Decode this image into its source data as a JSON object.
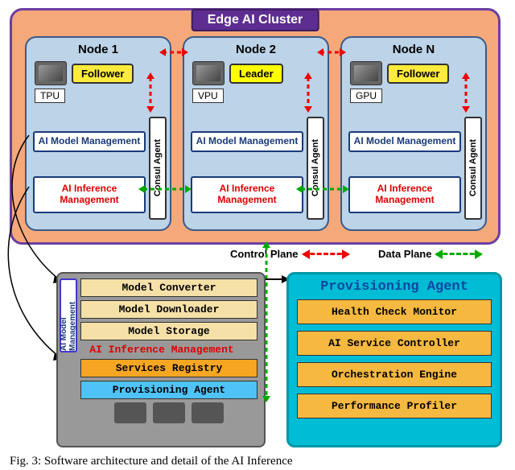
{
  "cluster": {
    "title": "Edge AI Cluster",
    "nodes": [
      {
        "name": "Node 1",
        "role": "Follower",
        "hw": "TPU",
        "model_mgmt": "AI Model Management",
        "infer_mgmt": "AI Inference Management",
        "consul": "Consul Agent"
      },
      {
        "name": "Node 2",
        "role": "Leader",
        "hw": "VPU",
        "model_mgmt": "AI Model Management",
        "infer_mgmt": "AI Inference Management",
        "consul": "Consul Agent"
      },
      {
        "name": "Node N",
        "role": "Follower",
        "hw": "GPU",
        "model_mgmt": "AI Model Management",
        "infer_mgmt": "AI Inference Management",
        "consul": "Consul Agent"
      }
    ]
  },
  "legend": {
    "control_plane": "Control Plane",
    "data_plane": "Data Plane"
  },
  "detail": {
    "vert_label": "AI Model Management",
    "model_rows": [
      "Model Converter",
      "Model Downloader",
      "Model Storage"
    ],
    "infer_title": "AI Inference Management",
    "services_registry": "Services Registry",
    "provisioning_agent": "Provisioning Agent"
  },
  "provisioning": {
    "title": "Provisioning Agent",
    "rows": [
      "Health Check Monitor",
      "AI Service Controller",
      "Orchestration Engine",
      "Performance Profiler"
    ]
  },
  "caption": "Fig. 3: Software architecture and detail of the AI Inference"
}
